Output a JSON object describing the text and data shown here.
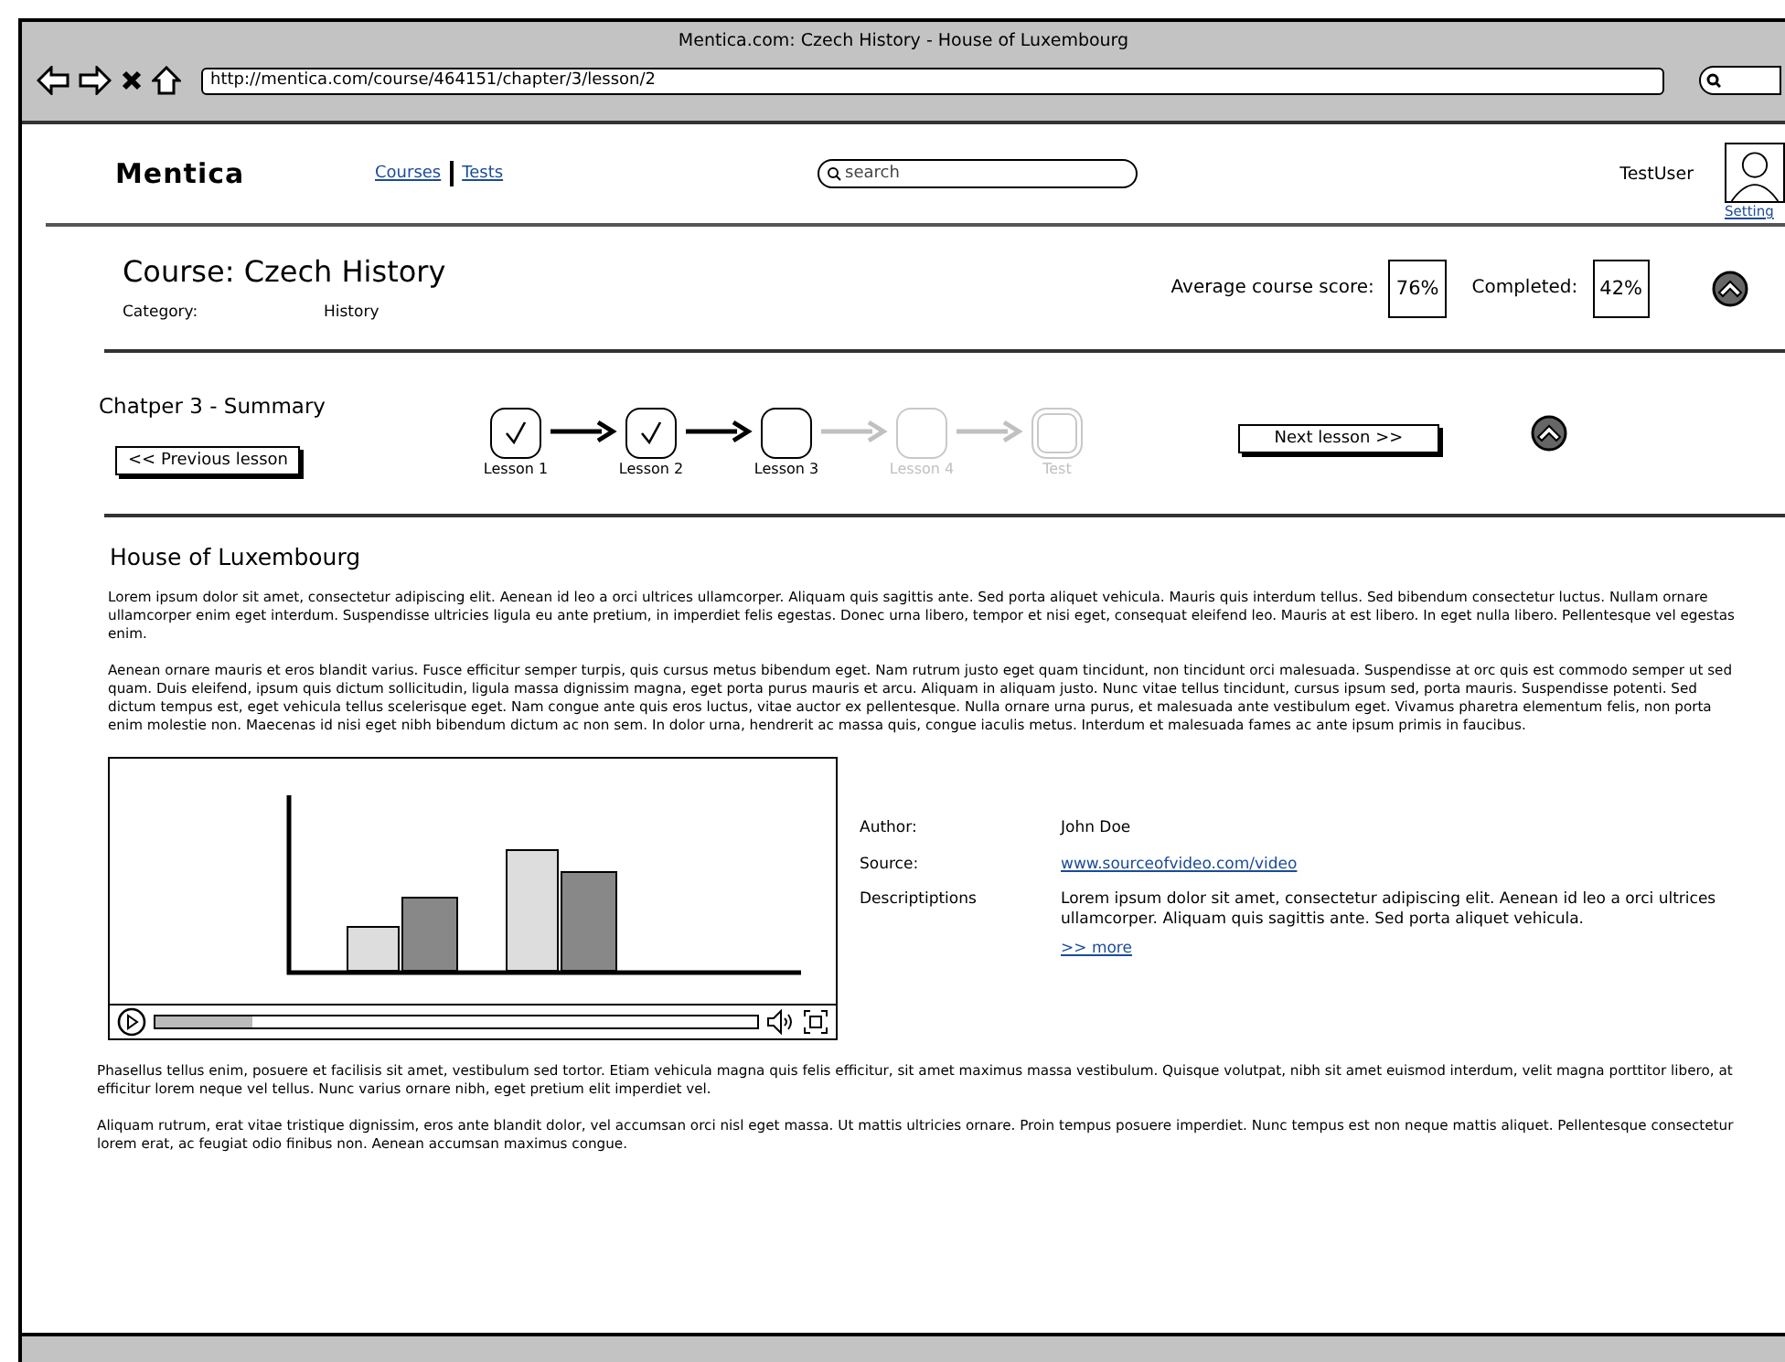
{
  "window": {
    "title": "Mentica.com: Czech History - House of Luxembourg"
  },
  "address_bar": {
    "url": "http://mentica.com/course/464151/chapter/3/lesson/2"
  },
  "header": {
    "logo": "Mentica",
    "nav": [
      {
        "label": "Courses"
      },
      {
        "label": "Tests"
      }
    ],
    "search": {
      "placeholder": "search"
    },
    "user": "TestUser",
    "settings": "Setting"
  },
  "course": {
    "title": "Course: Czech History",
    "category_label": "Category:",
    "category": "History",
    "score_label": "Average course score:",
    "score": "76%",
    "completed_label": "Completed:",
    "completed": "42%"
  },
  "chapter": {
    "title": "Chatper 3 - Summary",
    "prev_button": "<< Previous lesson",
    "next_button": "Next lesson >>",
    "steps": [
      {
        "label": "Lesson 1",
        "checked": true,
        "disabled": false
      },
      {
        "label": "Lesson 2",
        "checked": true,
        "disabled": false
      },
      {
        "label": "Lesson 3",
        "checked": false,
        "disabled": false
      },
      {
        "label": "Lesson 4",
        "checked": false,
        "disabled": true
      },
      {
        "label": "Test",
        "checked": false,
        "disabled": true
      }
    ]
  },
  "article": {
    "heading": "House of Luxembourg",
    "paragraphs_top": [
      "Lorem ipsum dolor sit amet, consectetur adipiscing elit. Aenean id leo a orci ultrices ullamcorper. Aliquam quis sagittis ante. Sed porta aliquet vehicula. Mauris quis interdum tellus. Sed bibendum consectetur luctus. Nullam ornare ullamcorper enim eget interdum. Suspendisse ultricies ligula eu ante pretium, in imperdiet felis egestas. Donec urna libero, tempor et nisi eget, consequat eleifend leo. Mauris at est libero. In eget nulla libero. Pellentesque vel egestas enim.",
      "Aenean ornare mauris et eros blandit varius. Fusce efficitur semper turpis, quis cursus metus bibendum eget. Nam rutrum justo eget quam tincidunt, non tincidunt orci malesuada. Suspendisse at orc quis est commodo semper ut sed quam. Duis eleifend, ipsum quis dictum sollicitudin, ligula massa dignissim magna, eget porta purus mauris et arcu. Aliquam in aliquam justo. Nunc vitae tellus tincidunt, cursus ipsum sed, porta mauris. Suspendisse potenti. Sed dictum tempus est, eget vehicula tellus scelerisque eget. Nam congue ante quis eros luctus, vitae auctor ex pellentesque. Nulla ornare urna purus, et malesuada ante vestibulum eget. Vivamus pharetra elementum felis, non porta enim molestie non. Maecenas id nisi eget nibh bibendum dictum ac non sem. In dolor urna, hendrerit ac massa quis, congue iaculis metus. Interdum et malesuada fames ac ante ipsum primis in faucibus."
    ],
    "video": {
      "level": 0.16
    },
    "meta": [
      {
        "kind": "text",
        "label": "Author:",
        "value": "John Doe"
      },
      {
        "kind": "link",
        "label": "Source:",
        "value": "www.sourceofvideo.com/video"
      },
      {
        "kind": "text",
        "label": "Descriptiptions",
        "value": "Lorem ipsum dolor sit amet, consectetur adipiscing elit. Aenean id leo a orci ultrices ullamcorper. Aliquam quis sagittis ante. Sed porta aliquet vehicula."
      }
    ],
    "more_link": ">> more",
    "paragraphs_bottom": [
      "Phasellus tellus enim, posuere et facilisis sit amet, vestibulum sed tortor. Etiam vehicula magna quis felis efficitur, sit amet maximus massa vestibulum. Quisque volutpat, nibh sit amet euismod interdum, velit magna porttitor libero, at efficitur lorem neque vel tellus. Nunc varius ornare nibh, eget pretium elit imperdiet vel.",
      "Aliquam rutrum, erat vitae tristique dignissim, eros ante blandit dolor, vel accumsan orci nisl eget massa. Ut mattis ultricies ornare. Proin tempus posuere imperdiet. Nunc tempus est non neque mattis aliquet. Pellentesque consectetur lorem erat, ac feugiat odio finibus non. Aenean accumsan maximus congue."
    ]
  }
}
